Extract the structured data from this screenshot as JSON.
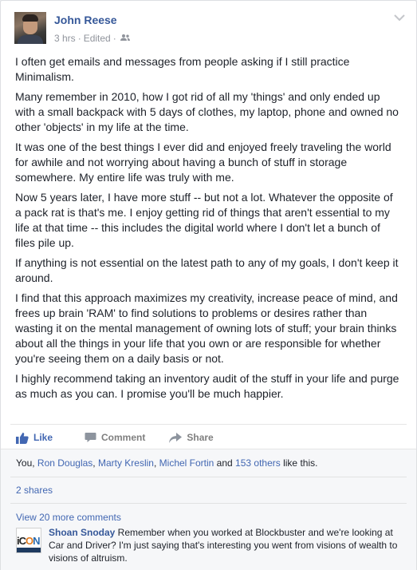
{
  "post": {
    "author": "John Reese",
    "meta": {
      "time": "3 hrs",
      "edited": "Edited",
      "dot": "·",
      "audience_icon": "friends-icon"
    },
    "paragraphs": [
      "I often get emails and messages from people asking if I still practice Minimalism.",
      "Many remember in 2010, how I got rid of all my 'things' and only ended up with a small backpack with 5 days of clothes, my laptop, phone and owned no other 'objects' in my life at the time.",
      "It was one of the best things I ever did and enjoyed freely traveling the world for awhile and not worrying about having a bunch of stuff in storage somewhere. My entire life was truly with me.",
      "Now 5 years later, I have more stuff -- but not a lot. Whatever the opposite of a pack rat is that's me. I enjoy getting rid of things that aren't essential to my life at that time -- this includes the digital world where I don't let a bunch of files pile up.",
      "If anything is not essential on the latest path to any of my goals, I don't keep it around.",
      "I find that this approach maximizes my creativity, increase peace of mind, and frees up brain 'RAM' to find solutions to problems or desires rather than wasting it on the mental management of owning lots of stuff; your brain thinks about all the things in your life that you own or are responsible for whether you're seeing them on a daily basis or not.",
      "I highly recommend taking an inventory audit of the stuff in your life and purge as much as you can. I promise you'll be much happier."
    ]
  },
  "actions": {
    "like": "Like",
    "comment": "Comment",
    "share": "Share"
  },
  "likes": {
    "prefix": "You, ",
    "names": [
      "Ron Douglas",
      "Marty Kreslin",
      "Michel Fortin"
    ],
    "sep": ", ",
    "and": " and ",
    "others": "153 others",
    "suffix": " like this."
  },
  "shares": "2 shares",
  "more_comments": "View 20 more comments",
  "comment": {
    "author": "Shoan Snoday",
    "text": " Remember when you worked at Blockbuster and we're looking at Car and Driver? I'm just saying that's interesting you went from visions of wealth to visions of altruism.",
    "avatar_letters": [
      "iC",
      "O",
      "N"
    ]
  },
  "colors": {
    "link": "#4267b2",
    "name": "#365899",
    "meta": "#90949c"
  }
}
